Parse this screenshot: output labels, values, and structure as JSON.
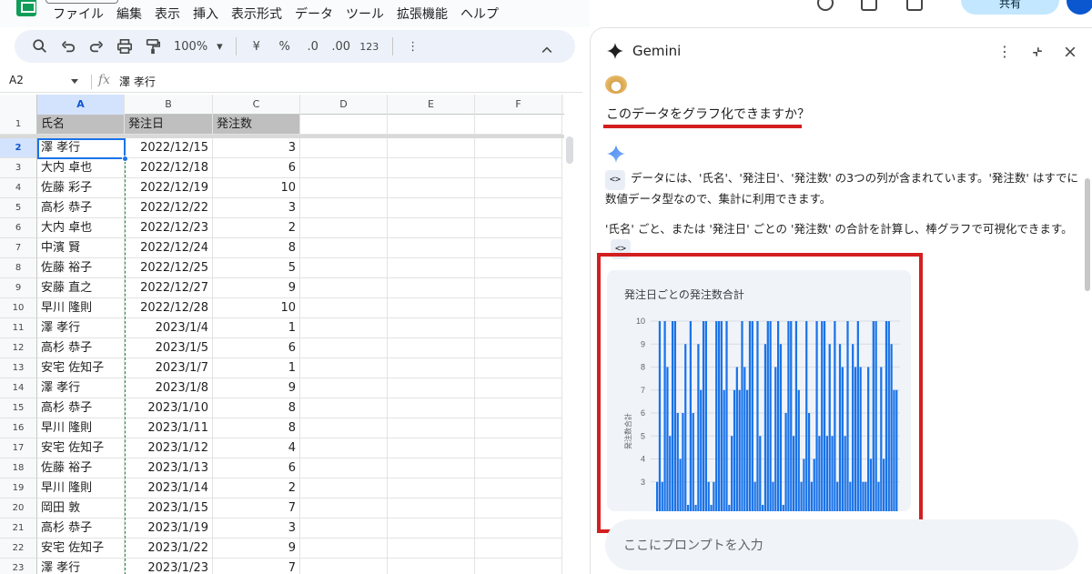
{
  "menubar": {
    "items": [
      "ファイル",
      "編集",
      "表示",
      "挿入",
      "表示形式",
      "データ",
      "ツール",
      "拡張機能",
      "ヘルプ"
    ],
    "share_label": "共有"
  },
  "toolbar": {
    "zoom": "100%",
    "currency": "¥",
    "percent": "%",
    "dec_decrease": ".0",
    "dec_increase": ".00",
    "number_format": "123"
  },
  "formula_bar": {
    "cell_ref": "A2",
    "fx": "fx",
    "value": "澤 孝行"
  },
  "sheet": {
    "columns": [
      "A",
      "B",
      "C",
      "D",
      "E",
      "F"
    ],
    "header": [
      "氏名",
      "発注日",
      "発注数"
    ],
    "rows": [
      {
        "n": "1"
      },
      {
        "n": "2",
        "name": "澤 孝行",
        "date": "2022/12/15",
        "qty": "3"
      },
      {
        "n": "3",
        "name": "大内 卓也",
        "date": "2022/12/18",
        "qty": "6"
      },
      {
        "n": "4",
        "name": "佐藤 彩子",
        "date": "2022/12/19",
        "qty": "10"
      },
      {
        "n": "5",
        "name": "高杉 恭子",
        "date": "2022/12/22",
        "qty": "3"
      },
      {
        "n": "6",
        "name": "大内 卓也",
        "date": "2022/12/23",
        "qty": "2"
      },
      {
        "n": "7",
        "name": "中濱 賢",
        "date": "2022/12/24",
        "qty": "8"
      },
      {
        "n": "8",
        "name": "佐藤 裕子",
        "date": "2022/12/25",
        "qty": "5"
      },
      {
        "n": "9",
        "name": "安藤 直之",
        "date": "2022/12/27",
        "qty": "9"
      },
      {
        "n": "10",
        "name": "早川 隆則",
        "date": "2022/12/28",
        "qty": "10"
      },
      {
        "n": "11",
        "name": "澤 孝行",
        "date": "2023/1/4",
        "qty": "1"
      },
      {
        "n": "12",
        "name": "高杉 恭子",
        "date": "2023/1/5",
        "qty": "6"
      },
      {
        "n": "13",
        "name": "安宅 佐知子",
        "date": "2023/1/7",
        "qty": "1"
      },
      {
        "n": "14",
        "name": "澤 孝行",
        "date": "2023/1/8",
        "qty": "9"
      },
      {
        "n": "15",
        "name": "高杉 恭子",
        "date": "2023/1/10",
        "qty": "8"
      },
      {
        "n": "16",
        "name": "早川 隆則",
        "date": "2023/1/11",
        "qty": "8"
      },
      {
        "n": "17",
        "name": "安宅 佐知子",
        "date": "2023/1/12",
        "qty": "4"
      },
      {
        "n": "18",
        "name": "佐藤 裕子",
        "date": "2023/1/13",
        "qty": "6"
      },
      {
        "n": "19",
        "name": "早川 隆則",
        "date": "2023/1/14",
        "qty": "2"
      },
      {
        "n": "20",
        "name": "岡田 敦",
        "date": "2023/1/15",
        "qty": "7"
      },
      {
        "n": "21",
        "name": "高杉 恭子",
        "date": "2023/1/19",
        "qty": "3"
      },
      {
        "n": "22",
        "name": "安宅 佐知子",
        "date": "2023/1/22",
        "qty": "9"
      },
      {
        "n": "23",
        "name": "澤 孝行",
        "date": "2023/1/23",
        "qty": "7"
      }
    ]
  },
  "gemini": {
    "title": "Gemini",
    "question": "このデータをグラフ化できますか？",
    "code_chip": "<>",
    "answer_p1": "データには、'氏名'、'発注日'、'発注数' の3つの列が含まれています。'発注数' はすでに数値データ型なので、集計に利用できます。",
    "answer_p2": "'氏名' ごと、または '発注日' ごとの '発注数' の合計を計算し、棒グラフで可視化できます。",
    "prompt_placeholder": "ここにプロンプトを入力"
  },
  "colors": {
    "accent": "#1a73e8",
    "bar": "#1a73e8",
    "highlight_red": "#d31f1f",
    "header_fill": "#bfbfbf"
  },
  "chart_data": {
    "type": "bar",
    "title": "発注日ごとの発注数合計",
    "xlabel": "",
    "ylabel": "発注数合計",
    "ylim": [
      2,
      10
    ],
    "yticks": [
      3,
      4,
      5,
      6,
      7,
      8,
      9,
      10
    ],
    "values": [
      3,
      10,
      3,
      10,
      8,
      5,
      10,
      10,
      6,
      4,
      6,
      9,
      2,
      10,
      6,
      2,
      9,
      7,
      10,
      10,
      3,
      2,
      3,
      10,
      10,
      10,
      7,
      10,
      2,
      5,
      7,
      8,
      7,
      10,
      8,
      7,
      10,
      10,
      3,
      10,
      5,
      2,
      9,
      10,
      10,
      3,
      8,
      10,
      9,
      2,
      6,
      10,
      10,
      5,
      10,
      7,
      3,
      4,
      10,
      6,
      3,
      4,
      10,
      5,
      10,
      10,
      5,
      9,
      5,
      10,
      3,
      9,
      8,
      5,
      10,
      3,
      9,
      8,
      10,
      8,
      3,
      3,
      8,
      4,
      10,
      10,
      3,
      8,
      4,
      10,
      10,
      9,
      7,
      7
    ]
  }
}
